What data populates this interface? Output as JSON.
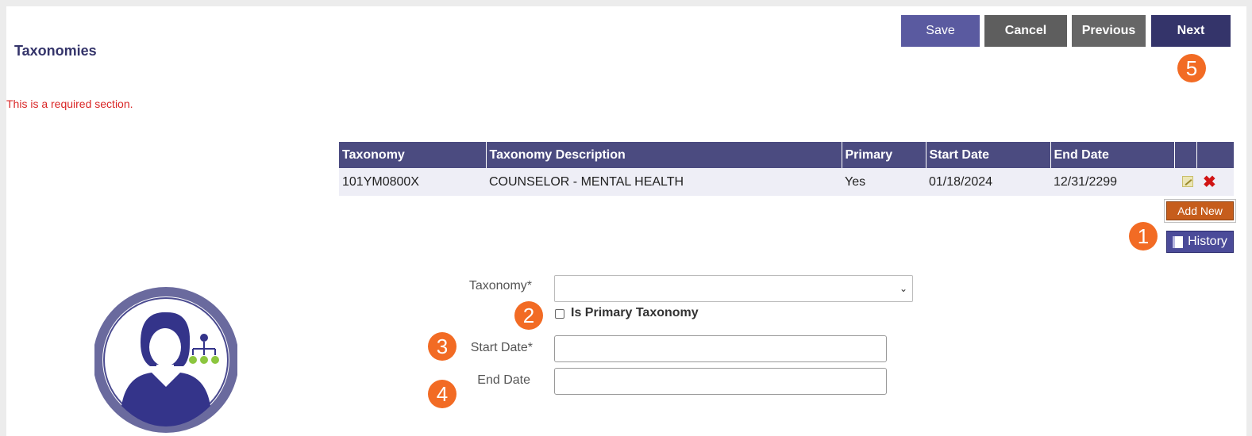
{
  "header": {
    "title": "Taxonomies",
    "required_message": "This is a required section."
  },
  "toolbar": {
    "save_label": "Save",
    "cancel_label": "Cancel",
    "previous_label": "Previous",
    "next_label": "Next"
  },
  "table": {
    "columns": [
      "Taxonomy",
      "Taxonomy Description",
      "Primary",
      "Start Date",
      "End Date"
    ],
    "rows": [
      {
        "taxonomy": "101YM0800X",
        "description": "COUNSELOR - MENTAL HEALTH",
        "primary": "Yes",
        "start_date": "01/18/2024",
        "end_date": "12/31/2299"
      }
    ]
  },
  "actions": {
    "add_new_label": "Add New",
    "history_label": "History"
  },
  "form": {
    "taxonomy_label": "Taxonomy*",
    "taxonomy_value": "",
    "primary_label": "Is Primary Taxonomy",
    "primary_checked": false,
    "start_date_label": "Start Date*",
    "start_date_value": "",
    "end_date_label": "End Date",
    "end_date_value": ""
  },
  "callouts": [
    "1",
    "2",
    "3",
    "4",
    "5"
  ],
  "colors": {
    "header_navy": "#34346a",
    "table_header": "#4b4b80",
    "add_new_orange": "#c65d1c",
    "callout_orange": "#f26b24",
    "required_red": "#d92626"
  },
  "icons": [
    "edit-icon",
    "delete-icon",
    "book-icon",
    "chevron-down-icon",
    "user-org-icon"
  ]
}
